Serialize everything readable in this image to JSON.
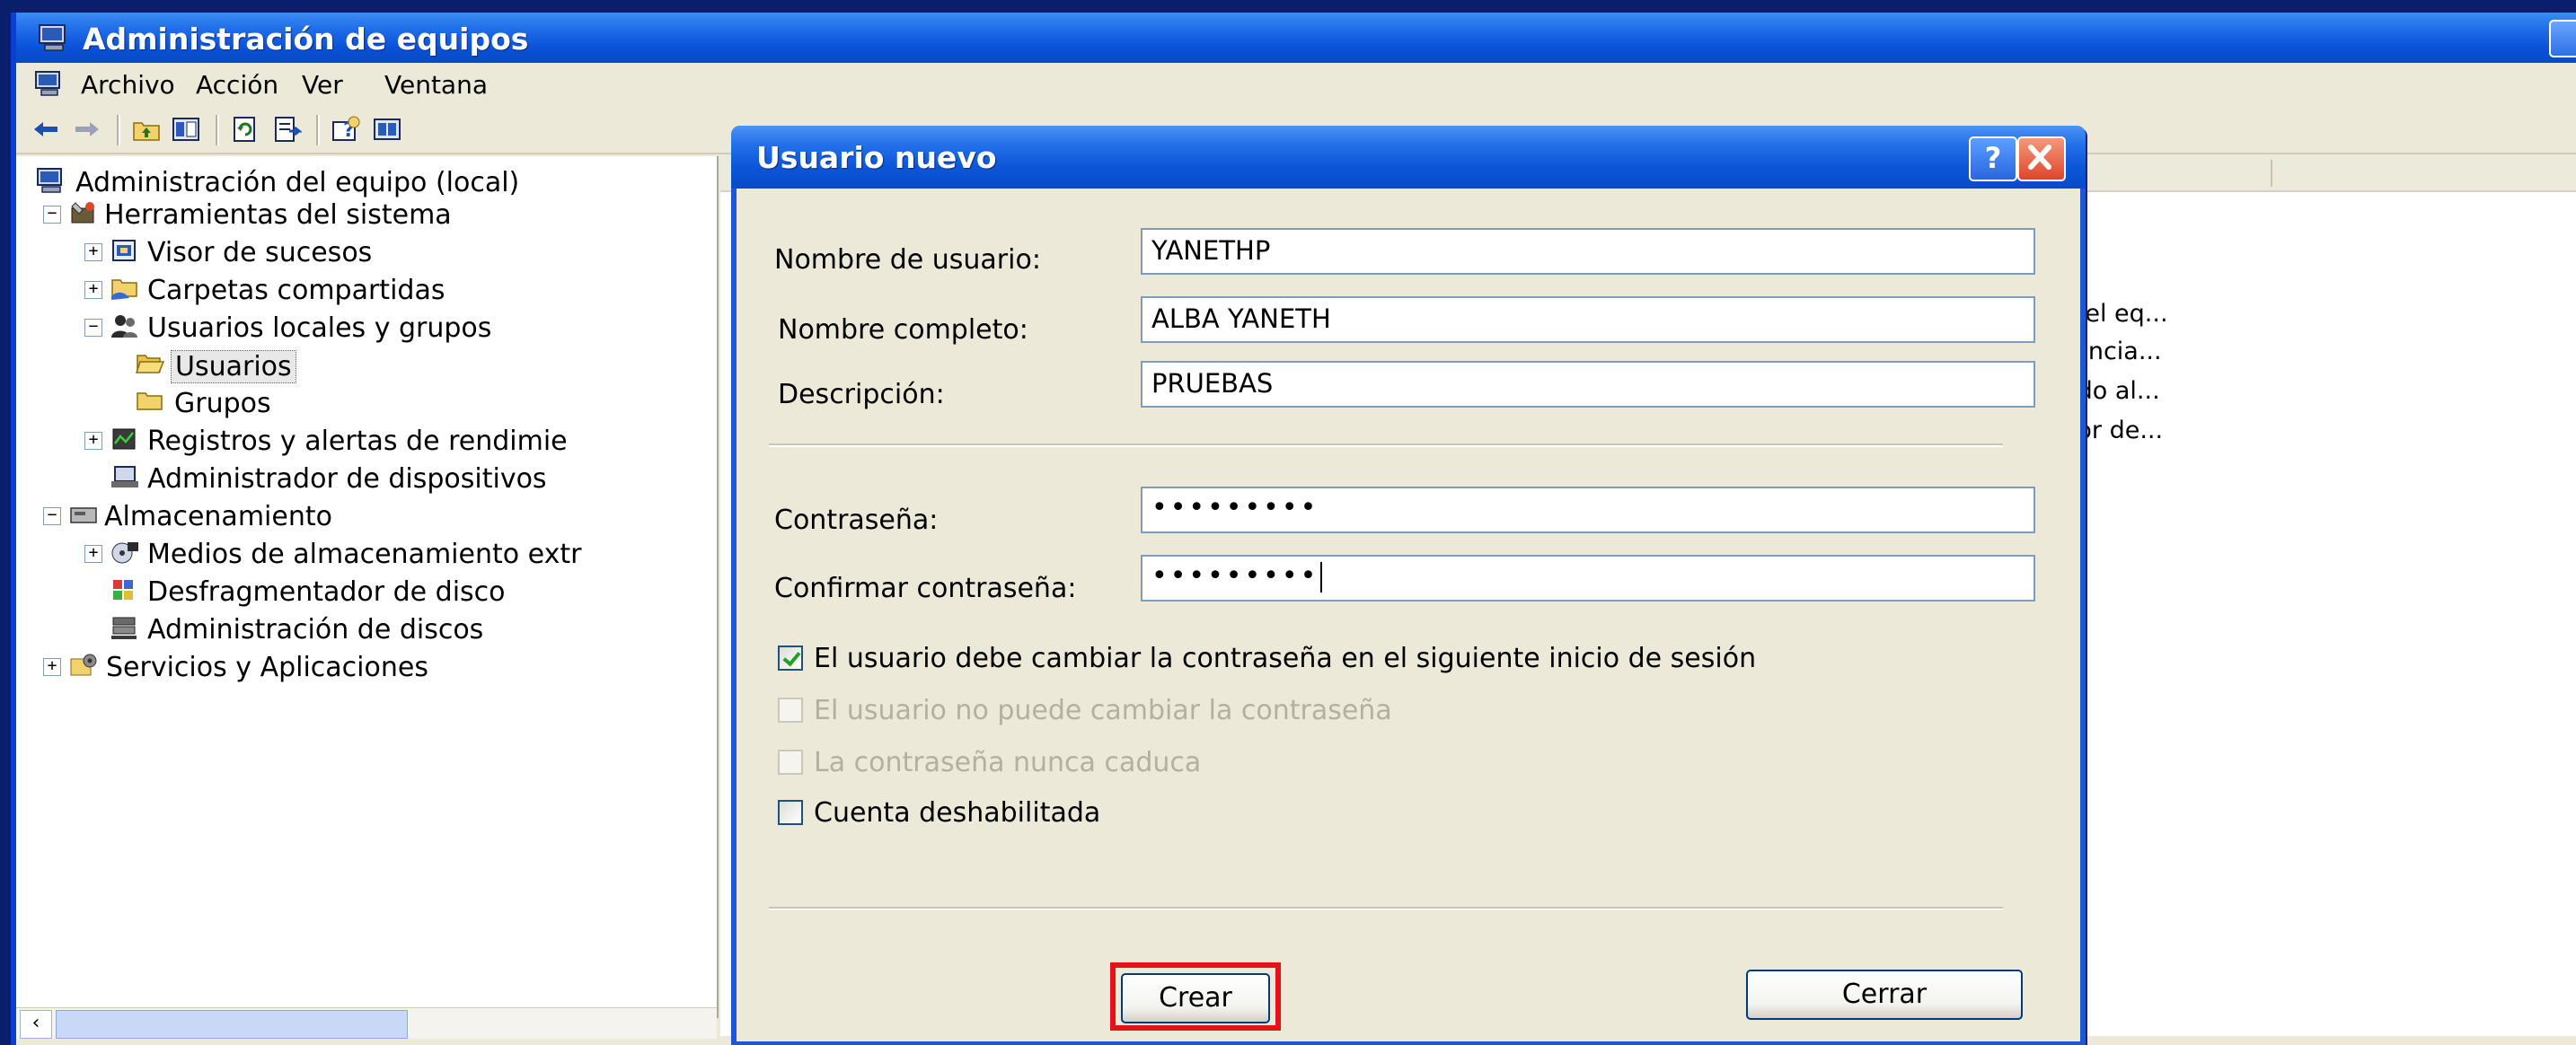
{
  "main_window": {
    "title": "Administración de equipos",
    "menu": [
      "Archivo",
      "Acción",
      "Ver",
      "Ventana"
    ]
  },
  "toolbar": {
    "icons": [
      "back-arrow-icon",
      "forward-arrow-icon",
      "up-folder-icon",
      "show-hide-tree-icon",
      "refresh-icon",
      "export-list-icon",
      "help-icon",
      "console-icon"
    ]
  },
  "tree": {
    "root": "Administración del equipo (local)",
    "system_tools": "Herramientas del sistema",
    "event_viewer": "Visor de sucesos",
    "shared_folders": "Carpetas compartidas",
    "local_users_groups": "Usuarios locales y grupos",
    "users": "Usuarios",
    "groups": "Grupos",
    "perf_logs": "Registros y alertas de rendimie",
    "device_manager": "Administrador de dispositivos",
    "storage": "Almacenamiento",
    "removable_storage": "Medios de almacenamiento extr",
    "defrag": "Desfragmentador de disco",
    "disk_management": "Administración de discos",
    "services_apps": "Servicios y Aplicaciones"
  },
  "list": {
    "descriptions": [
      "ón del eq...",
      "sistencia...",
      "vitado al...",
      "eedor de..."
    ]
  },
  "dialog": {
    "title": "Usuario nuevo",
    "help_label": "?",
    "username_label": "Nombre de usuario:",
    "username_value": "YANETHP",
    "fullname_label": "Nombre completo:",
    "fullname_value": "ALBA YANETH",
    "description_label": "Descripción:",
    "description_value": "PRUEBAS",
    "password_label": "Contraseña:",
    "password_value": "•••••••••",
    "confirm_label": "Confirmar contraseña:",
    "confirm_value": "•••••••••",
    "checkboxes": [
      {
        "label": "El usuario debe cambiar la contraseña en el siguiente inicio de sesión",
        "checked": true,
        "enabled": true
      },
      {
        "label": "El usuario no puede cambiar la contraseña",
        "checked": false,
        "enabled": false
      },
      {
        "label": "La contraseña nunca caduca",
        "checked": false,
        "enabled": false
      },
      {
        "label": "Cuenta deshabilitada",
        "checked": false,
        "enabled": true
      }
    ],
    "create_label": "Crear",
    "close_label": "Cerrar"
  },
  "colors": {
    "title_bar": "#0a52d8",
    "highlight": "#e1141b",
    "window_face": "#ece9d8"
  }
}
